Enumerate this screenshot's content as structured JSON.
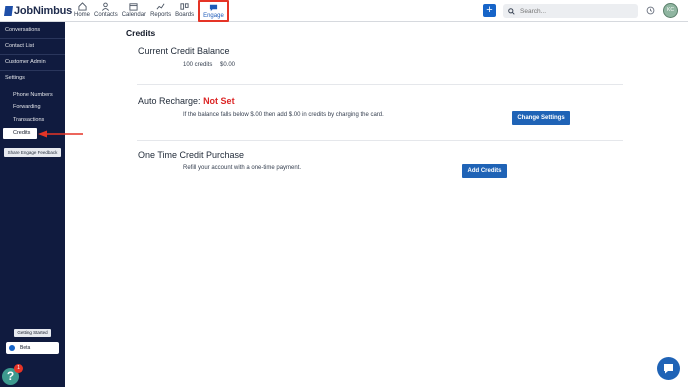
{
  "brand": {
    "name": "JobNimbus"
  },
  "nav": {
    "items": [
      {
        "label": "Home",
        "icon": "home-icon"
      },
      {
        "label": "Contacts",
        "icon": "person-icon"
      },
      {
        "label": "Calendar",
        "icon": "calendar-icon"
      },
      {
        "label": "Reports",
        "icon": "chart-icon"
      },
      {
        "label": "Boards",
        "icon": "board-icon"
      },
      {
        "label": "Engage",
        "icon": "chat-icon",
        "active": true
      }
    ]
  },
  "topbar": {
    "add_label": "+",
    "search_placeholder": "Search...",
    "avatar_initials": "KC"
  },
  "sidebar": {
    "conversations": "Conversations",
    "contact_list": "Contact List",
    "customer_admin": "Customer Admin",
    "settings": "Settings",
    "phone_numbers": "Phone Numbers",
    "forwarding": "Forwarding",
    "transactions": "Transactions",
    "credits": "Credits",
    "feedback": "Share Engage Feedback",
    "getting_started": "Getting Started",
    "beta": "Beta",
    "help_badge": "1",
    "help_mark": "?"
  },
  "main": {
    "page_title": "Credits",
    "balance": {
      "title": "Current Credit Balance",
      "credits": "100 credits",
      "amount": "$0.00"
    },
    "auto_recharge": {
      "title": "Auto Recharge:",
      "status": "Not Set",
      "description": "If the balance falls below $.00 then add $.00 in credits by charging the card.",
      "button": "Change Settings"
    },
    "one_time": {
      "title": "One Time Credit Purchase",
      "description": "Refill your account with a one-time payment.",
      "button": "Add Credits"
    }
  },
  "colors": {
    "sidebar_bg": "#101b3f",
    "accent_blue": "#1f63b6",
    "highlight_red": "#e53426",
    "status_red": "#dc2626"
  }
}
